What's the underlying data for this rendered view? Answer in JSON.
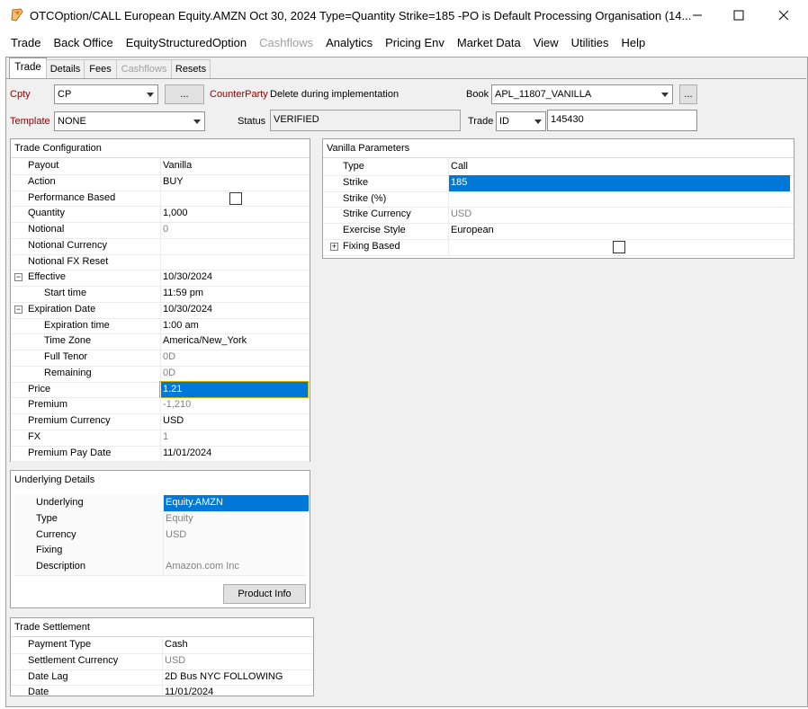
{
  "window": {
    "title": "OTCOption/CALL European Equity.AMZN Oct 30, 2024 Type=Quantity Strike=185  -PO is Default Processing Organisation  (14..."
  },
  "menu": [
    "Trade",
    "Back Office",
    "EquityStructuredOption",
    "Cashflows",
    "Analytics",
    "Pricing Env",
    "Market Data",
    "View",
    "Utilities",
    "Help"
  ],
  "tabs": [
    "Trade",
    "Details",
    "Fees",
    "Cashflows",
    "Resets"
  ],
  "header": {
    "cpty_label": "Cpty",
    "cpty_value": "CP",
    "ellipsis": "...",
    "counterparty_label": "CounterParty",
    "counterparty_value": "Delete during implementation",
    "book_label": "Book",
    "book_value": "APL_11807_VANILLA",
    "template_label": "Template",
    "template_value": "NONE",
    "status_label": "Status",
    "status_value": "VERIFIED",
    "trade_label": "Trade",
    "trade_id_type": "ID",
    "trade_id": "145430"
  },
  "trade_config": {
    "title": "Trade Configuration",
    "rows": [
      {
        "label": "Payout",
        "value": "Vanilla"
      },
      {
        "label": "Action",
        "value": "BUY"
      },
      {
        "label": "Performance Based",
        "value": ""
      },
      {
        "label": "Quantity",
        "value": "1,000"
      },
      {
        "label": "Notional",
        "value": "0"
      },
      {
        "label": "Notional Currency",
        "value": ""
      },
      {
        "label": "Notional FX Reset",
        "value": ""
      },
      {
        "label": "Effective",
        "value": "10/30/2024"
      },
      {
        "label": "Start time",
        "value": "11:59 pm"
      },
      {
        "label": "Expiration Date",
        "value": "10/30/2024"
      },
      {
        "label": "Expiration time",
        "value": "1:00 am"
      },
      {
        "label": "Time Zone",
        "value": "America/New_York"
      },
      {
        "label": "Full Tenor",
        "value": "0D"
      },
      {
        "label": "Remaining",
        "value": "0D"
      },
      {
        "label": "Price",
        "value": "1.21"
      },
      {
        "label": "Premium",
        "value": "-1,210"
      },
      {
        "label": "Premium Currency",
        "value": "USD"
      },
      {
        "label": "FX",
        "value": "1"
      },
      {
        "label": "Premium Pay Date",
        "value": "11/01/2024"
      }
    ]
  },
  "vanilla": {
    "title": "Vanilla Parameters",
    "rows": [
      {
        "label": "Type",
        "value": "Call"
      },
      {
        "label": "Strike",
        "value": "185"
      },
      {
        "label": "Strike (%)",
        "value": ""
      },
      {
        "label": "Strike Currency",
        "value": "USD"
      },
      {
        "label": "Exercise Style",
        "value": "European"
      },
      {
        "label": "Fixing Based",
        "value": ""
      }
    ]
  },
  "underlying": {
    "title": "Underlying Details",
    "rows": [
      {
        "label": "Underlying",
        "value": "Equity.AMZN"
      },
      {
        "label": "Type",
        "value": "Equity"
      },
      {
        "label": "Currency",
        "value": "USD"
      },
      {
        "label": "Fixing",
        "value": ""
      },
      {
        "label": "Description",
        "value": "Amazon.com Inc"
      }
    ],
    "product_info": "Product Info"
  },
  "settlement": {
    "title": "Trade Settlement",
    "rows": [
      {
        "label": "Payment Type",
        "value": "Cash"
      },
      {
        "label": "Settlement Currency",
        "value": "USD"
      },
      {
        "label": "Date Lag",
        "value": "2D Bus NYC FOLLOWING"
      },
      {
        "label": "Date",
        "value": "11/01/2024"
      }
    ]
  }
}
